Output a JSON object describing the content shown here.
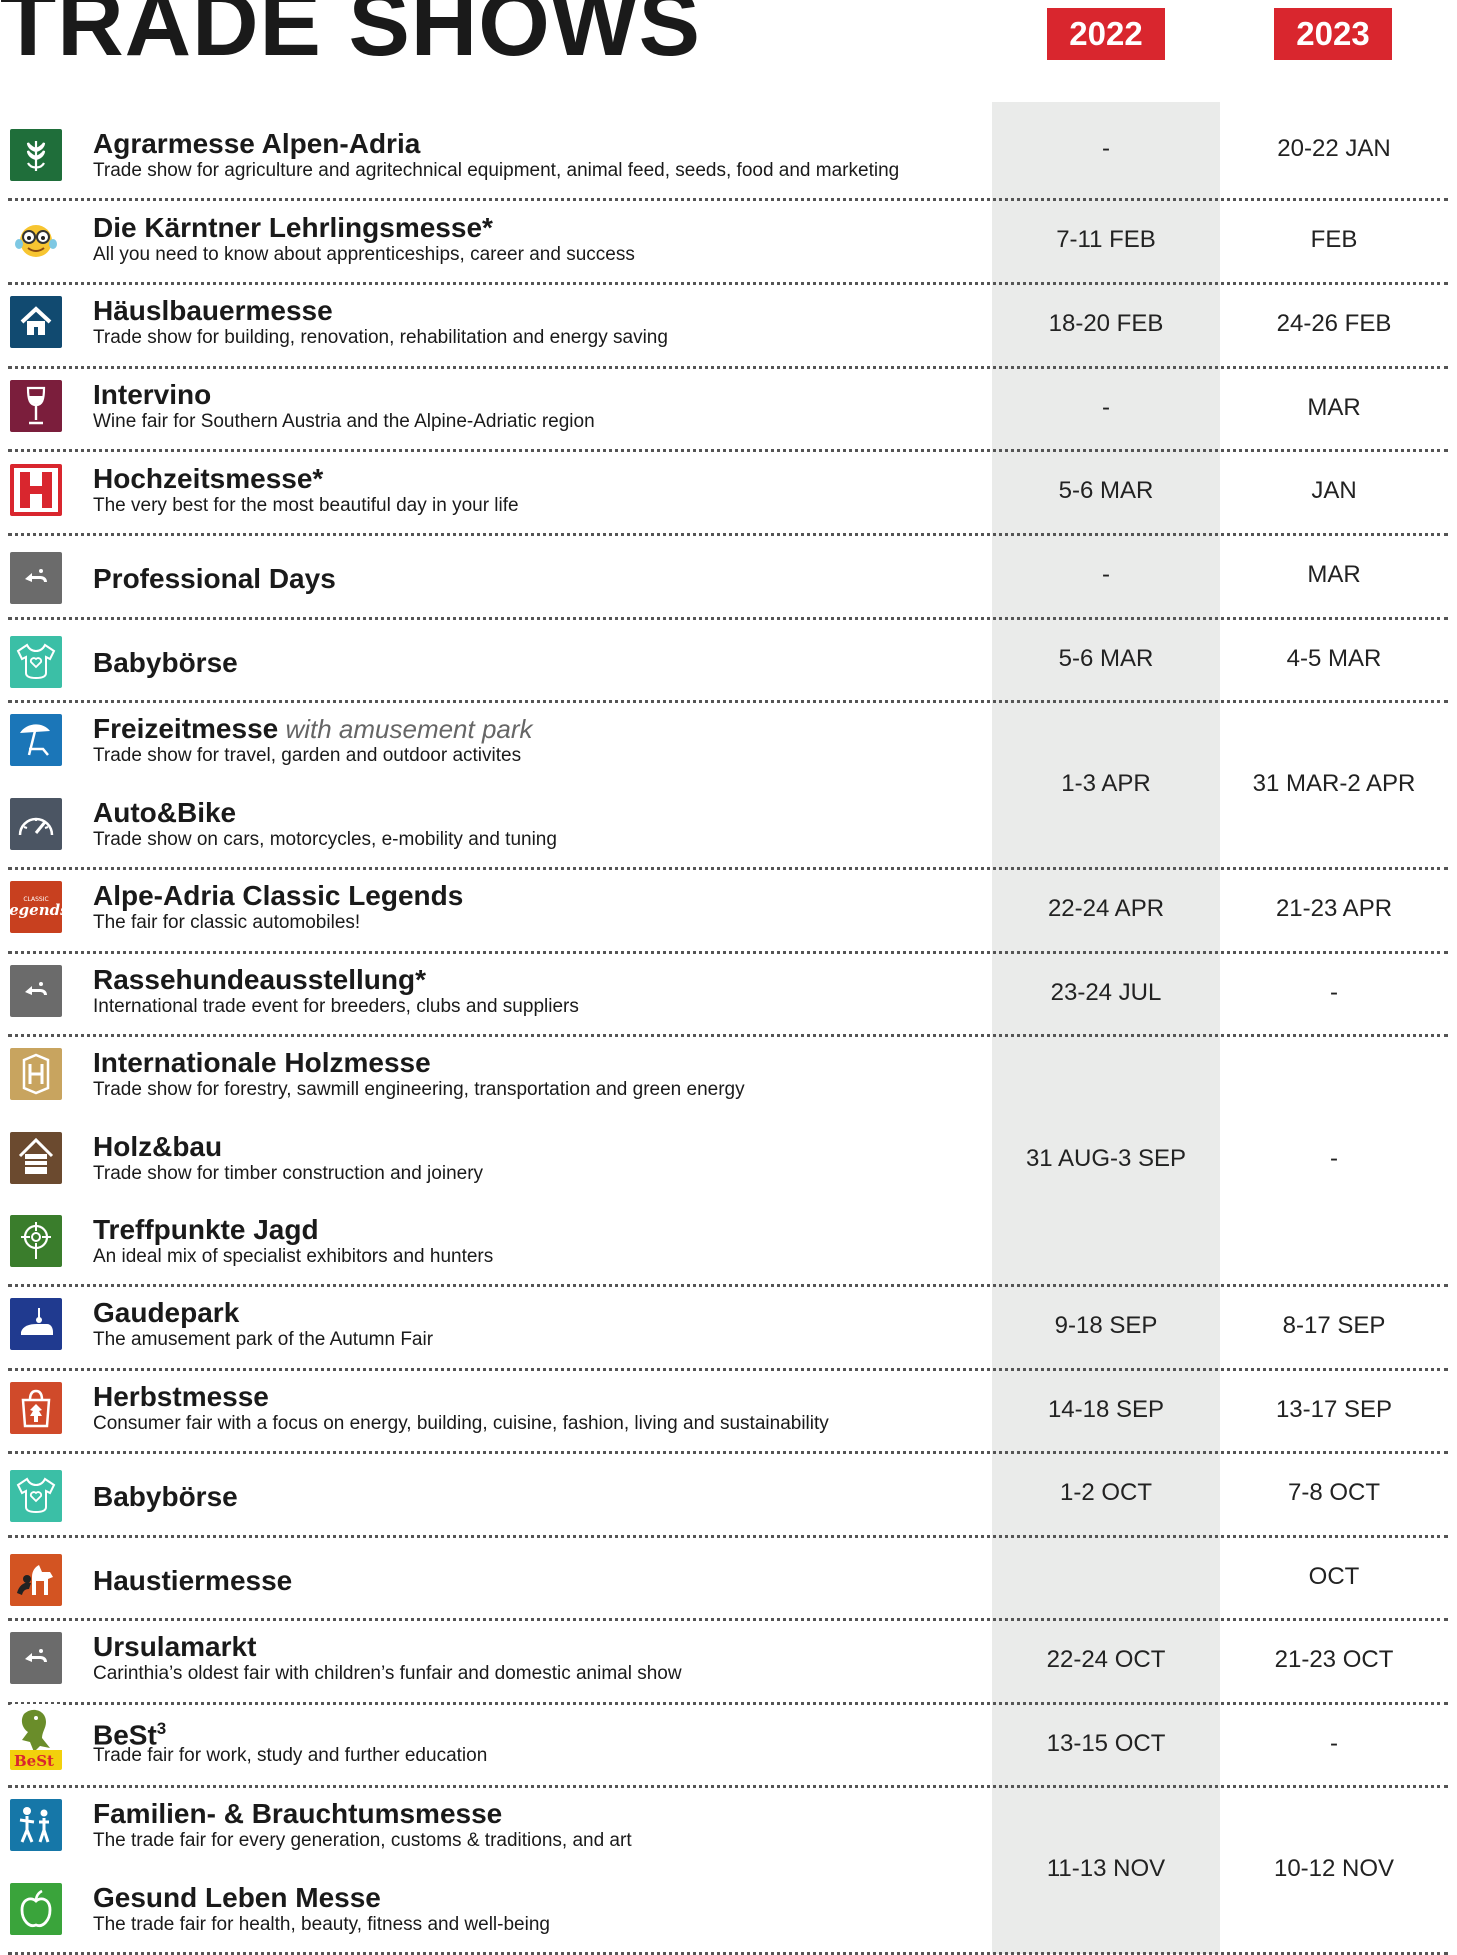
{
  "header": {
    "title": "TRADE SHOWS",
    "year1": "2022",
    "year2": "2023"
  },
  "colors": {
    "accent": "#d9262e",
    "band": "#eaebea"
  },
  "groups": [
    {
      "dates": [
        "-",
        "20-22 JAN"
      ],
      "entries": [
        {
          "name": "Agrarmesse Alpen-Adria",
          "desc": "Trade show for agriculture and agritechnical equipment, animal feed, seeds, food and marketing",
          "icon": "wheat-icon"
        }
      ]
    },
    {
      "dates": [
        "7-11 FEB",
        "FEB"
      ],
      "entries": [
        {
          "name": "Die Kärntner Lehrlingsmesse*",
          "desc": "All you need to know about apprenticeships, career and success",
          "icon": "emoji-glasses-icon"
        }
      ]
    },
    {
      "dates": [
        "18-20 FEB",
        "24-26 FEB"
      ],
      "entries": [
        {
          "name": "Häuslbauermesse",
          "desc": "Trade show for building, renovation, rehabilitation and energy saving",
          "icon": "house-icon"
        }
      ]
    },
    {
      "dates": [
        "-",
        "MAR"
      ],
      "entries": [
        {
          "name": "Intervino",
          "desc": "Wine fair for Southern Austria and the Alpine-Adriatic region",
          "icon": "wine-glass-icon"
        }
      ]
    },
    {
      "dates": [
        "5-6 MAR",
        "JAN"
      ],
      "entries": [
        {
          "name": "Hochzeitsmesse*",
          "desc": "The very best for the most beautiful day in your life",
          "icon": "hochzeit-logo-icon"
        }
      ]
    },
    {
      "dates": [
        "-",
        "MAR"
      ],
      "entries": [
        {
          "name": "Professional Days",
          "desc": "",
          "icon": "messe-arrow-icon"
        }
      ]
    },
    {
      "dates": [
        "5-6 MAR",
        "4-5 MAR"
      ],
      "entries": [
        {
          "name": "Babybörse",
          "desc": "",
          "icon": "baby-bodysuit-icon"
        }
      ]
    },
    {
      "dates": [
        "1-3 APR",
        "31 MAR-2 APR"
      ],
      "entries": [
        {
          "name": "Freizeitmesse",
          "note": "with amusement park",
          "desc": "Trade show for travel, garden and outdoor activites",
          "icon": "beach-umbrella-icon"
        },
        {
          "name": "Auto&Bike",
          "desc": "Trade show on cars, motorcycles, e-mobility and tuning",
          "icon": "speedometer-icon"
        }
      ]
    },
    {
      "dates": [
        "22-24 APR",
        "21-23 APR"
      ],
      "entries": [
        {
          "name": "Alpe-Adria Classic Legends",
          "desc": "The fair for classic automobiles!",
          "icon": "legends-logo-icon"
        }
      ]
    },
    {
      "dates": [
        "23-24 JUL",
        "-"
      ],
      "entries": [
        {
          "name": "Rassehundeausstellung*",
          "desc": "International trade event for breeders, clubs and suppliers",
          "icon": "messe-arrow-icon"
        }
      ]
    },
    {
      "dates": [
        "31 AUG-3 SEP",
        "-"
      ],
      "entries": [
        {
          "name": "Internationale Holzmesse",
          "desc": "Trade show for forestry, sawmill engineering, transportation and green energy",
          "icon": "holz-logo-icon"
        },
        {
          "name": "Holz&bau",
          "desc": "Trade show for timber construction and joinery",
          "icon": "timber-house-icon"
        },
        {
          "name": "Treffpunkte Jagd",
          "desc": "An ideal mix of specialist exhibitors and hunters",
          "icon": "crosshair-icon"
        }
      ]
    },
    {
      "dates": [
        "9-18 SEP",
        "8-17 SEP"
      ],
      "entries": [
        {
          "name": "Gaudepark",
          "desc": "The amusement park of the Autumn Fair",
          "icon": "bumper-car-icon"
        }
      ]
    },
    {
      "dates": [
        "14-18 SEP",
        "13-17 SEP"
      ],
      "entries": [
        {
          "name": "Herbstmesse",
          "desc": "Consumer fair with a focus on energy, building, cuisine, fashion, living and sustainability",
          "icon": "shopping-bag-leaf-icon"
        }
      ]
    },
    {
      "dates": [
        "1-2 OCT",
        "7-8 OCT"
      ],
      "entries": [
        {
          "name": "Babybörse",
          "desc": "",
          "icon": "baby-bodysuit-icon"
        }
      ]
    },
    {
      "dates": [
        "",
        "OCT"
      ],
      "entries": [
        {
          "name": "Haustiermesse",
          "desc": "",
          "icon": "pets-icon"
        }
      ]
    },
    {
      "dates": [
        "22-24 OCT",
        "21-23 OCT"
      ],
      "entries": [
        {
          "name": "Ursulamarkt",
          "desc": "Carinthia’s oldest fair with children’s funfair and domestic animal show",
          "icon": "messe-arrow-icon"
        }
      ]
    },
    {
      "dates": [
        "13-15 OCT",
        "-"
      ],
      "entries": [
        {
          "name": "BeSt",
          "sup": "3",
          "desc": "Trade fair for work, study and further education",
          "icon": "best-dragon-logo-icon"
        }
      ]
    },
    {
      "dates": [
        "11-13 NOV",
        "10-12 NOV"
      ],
      "entries": [
        {
          "name": "Familien- & Brauchtumsmesse",
          "desc": "The trade fair for every generation, customs & traditions, and art",
          "icon": "family-icon"
        },
        {
          "name": "Gesund Leben Messe",
          "desc": "The trade fair for health, beauty, fitness and well-being",
          "icon": "apple-icon"
        }
      ]
    }
  ]
}
